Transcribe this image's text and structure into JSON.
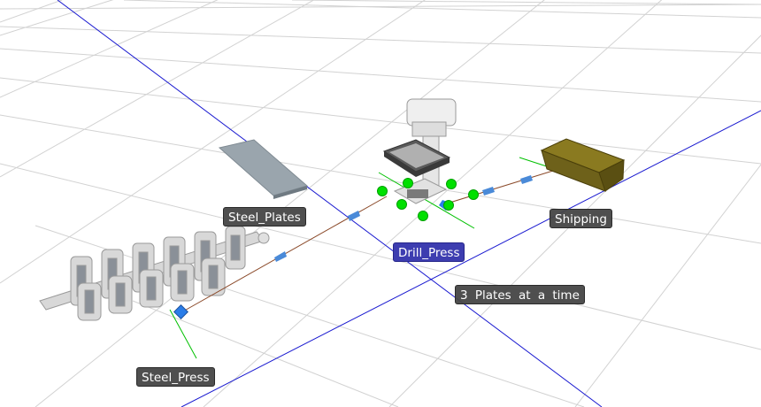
{
  "scene": {
    "background_color": "#ffffff",
    "grid_color": "#cfcfcf",
    "axis_color": "#1a1ad0",
    "route_color": "#8b4a2a",
    "handle_color": "#00e000",
    "anchor_color": "#2a7de8"
  },
  "objects": {
    "steel_plates": {
      "label": "Steel_Plates"
    },
    "steel_press": {
      "label": "Steel_Press"
    },
    "drill_press": {
      "label": "Drill_Press",
      "selected": true
    },
    "shipping": {
      "label": "Shipping"
    }
  },
  "annotation": {
    "text": "3 Plates at a time"
  }
}
